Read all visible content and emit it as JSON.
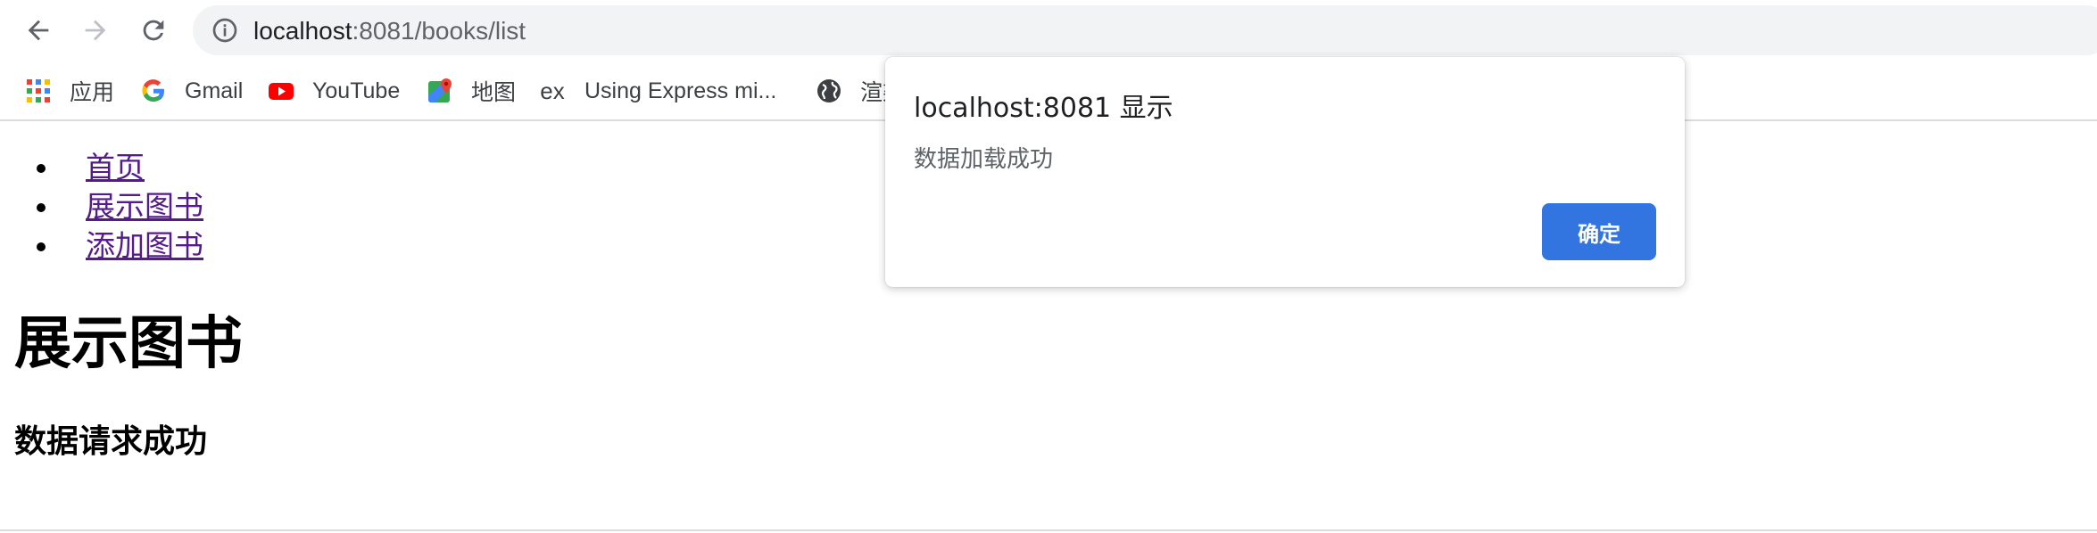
{
  "browser": {
    "url_host": "localhost",
    "url_rest": ":8081/books/list",
    "icons": {
      "back": "arrow-left-icon",
      "forward": "arrow-right-icon",
      "reload": "reload-icon",
      "site_info": "info-icon"
    }
  },
  "bookmarks": [
    {
      "label": "应用",
      "icon": "apps-grid-icon"
    },
    {
      "label": "Gmail",
      "icon": "google-g-icon"
    },
    {
      "label": "YouTube",
      "icon": "youtube-icon"
    },
    {
      "label": "地图",
      "icon": "maps-pin-icon"
    },
    {
      "label": "Using Express mi...",
      "icon": "express-icon",
      "icon_text": "ex"
    },
    {
      "label": "渲染",
      "icon": "globe-icon"
    }
  ],
  "page": {
    "nav": [
      "首页",
      "展示图书",
      "添加图书"
    ],
    "heading": "展示图书",
    "subheading": "数据请求成功"
  },
  "dialog": {
    "title": "localhost:8081 显示",
    "message": "数据加载成功",
    "ok_label": "确定",
    "ok_color": "#3275e0"
  }
}
